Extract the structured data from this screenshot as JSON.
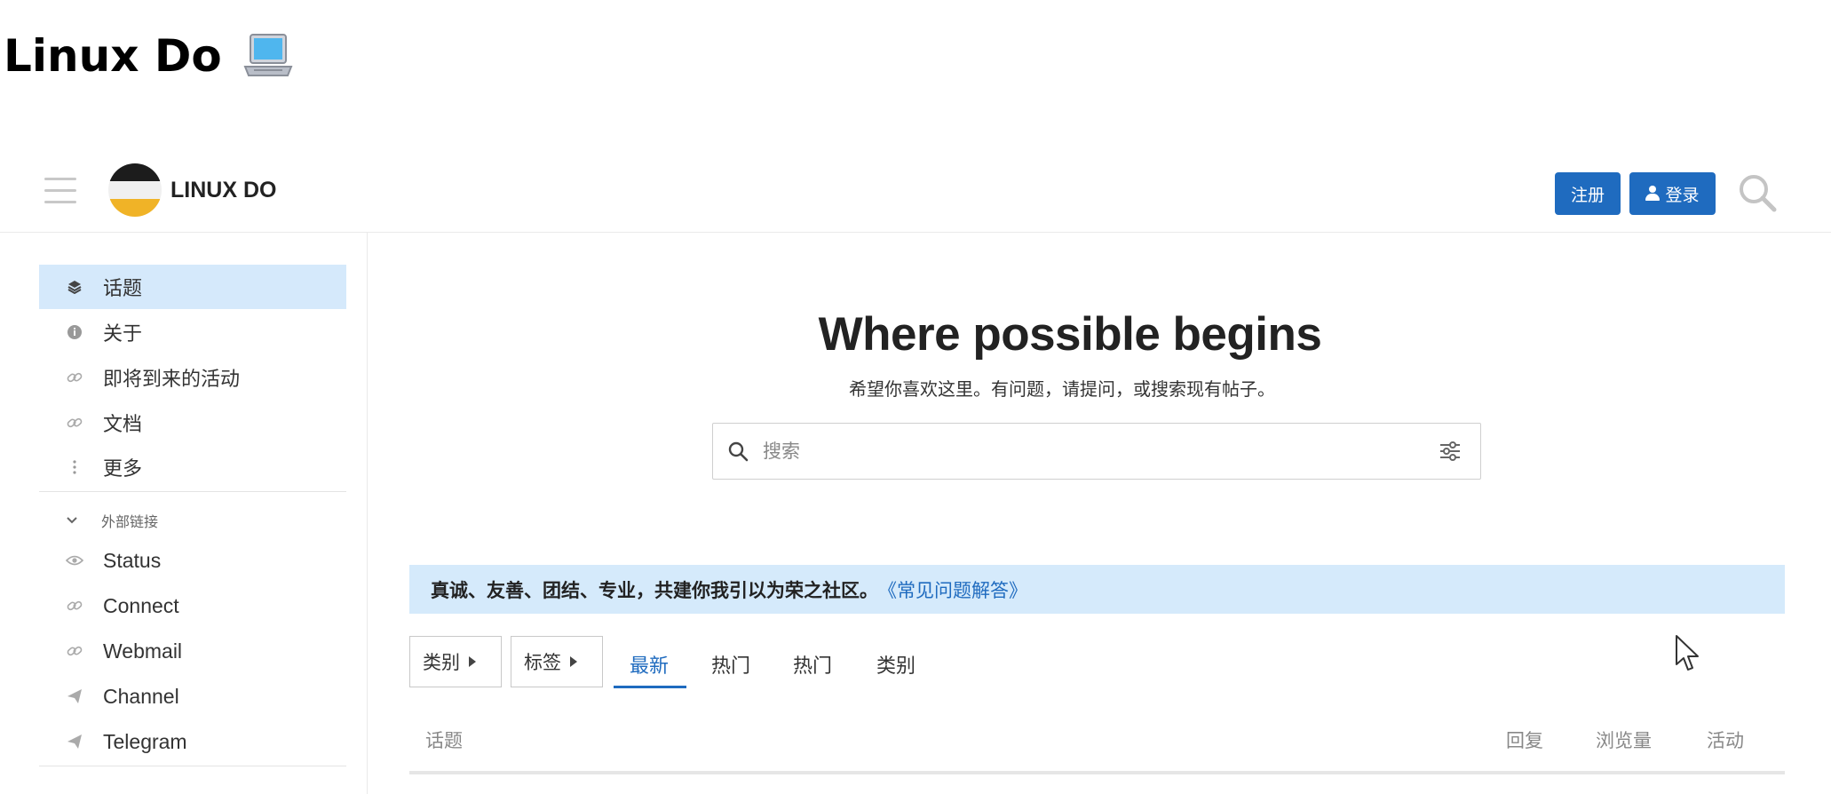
{
  "page": {
    "title": "Linux Do",
    "title_icon": "laptop-icon"
  },
  "header": {
    "site_name": "LINUX DO",
    "register_label": "注册",
    "login_label": "登录"
  },
  "sidebar": {
    "items": [
      {
        "label": "话题",
        "icon": "layers-icon"
      },
      {
        "label": "关于",
        "icon": "info-icon"
      },
      {
        "label": "即将到来的活动",
        "icon": "link-icon"
      },
      {
        "label": "文档",
        "icon": "link-icon"
      },
      {
        "label": "更多",
        "icon": "more-icon"
      }
    ],
    "section_label": "外部链接",
    "external_links": [
      {
        "label": "Status",
        "icon": "eye-icon"
      },
      {
        "label": "Connect",
        "icon": "link-icon"
      },
      {
        "label": "Webmail",
        "icon": "link-icon"
      },
      {
        "label": "Channel",
        "icon": "send-icon"
      },
      {
        "label": "Telegram",
        "icon": "send-icon"
      }
    ]
  },
  "hero": {
    "title": "Where possible begins",
    "subtitle": "希望你喜欢这里。有问题，请提问，或搜索现有帖子。",
    "search_placeholder": "搜索"
  },
  "banner": {
    "text": "真诚、友善、团结、专业，共建你我引以为荣之社区。",
    "link": "《常见问题解答》"
  },
  "nav": {
    "category_dropdown": "类别",
    "tag_dropdown": "标签",
    "tabs": [
      "最新",
      "热门",
      "热门",
      "类别"
    ],
    "active_tab": "最新"
  },
  "table": {
    "columns": [
      "话题",
      "回复",
      "浏览量",
      "活动"
    ]
  },
  "colors": {
    "accent": "#1f6bbf",
    "highlight": "#d5eafb"
  }
}
